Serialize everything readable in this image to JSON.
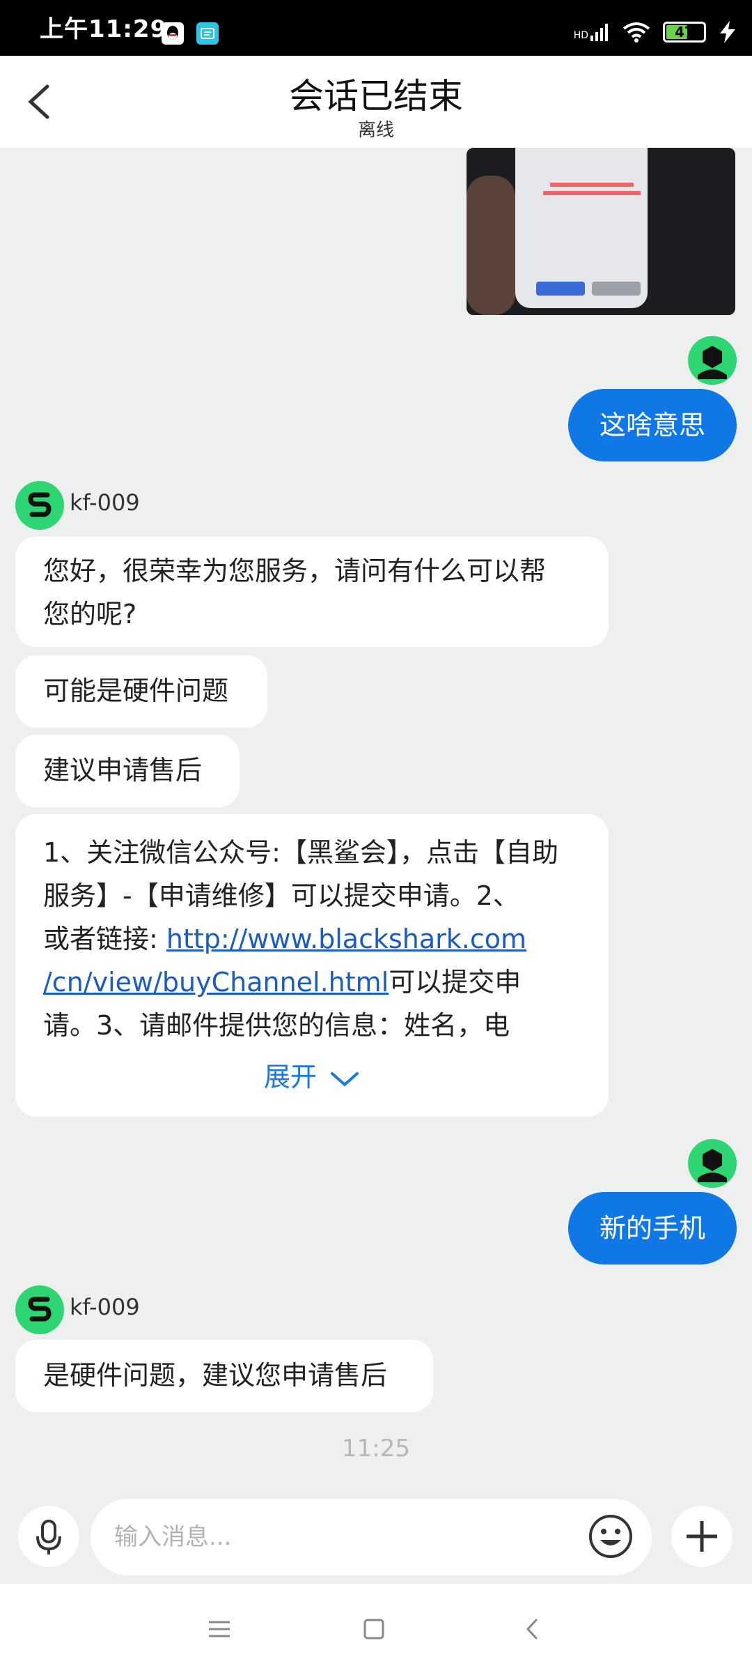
{
  "status_bar": {
    "time": "上午11:29",
    "network": "HD",
    "battery": "47"
  },
  "header": {
    "title": "会话已结束",
    "subtitle": "离线"
  },
  "messages": {
    "user1": "这啥意思",
    "bot_name1": "kf-009",
    "bot1_a": "您好，很荣幸为您服务，请问有什么可以帮",
    "bot1_b": "您的呢?",
    "bot2": "可能是硬件问题",
    "bot3": "建议申请售后",
    "bot4": {
      "line1": "1、关注微信公众号:【黑鲨会】，点击【自助",
      "line2": "服务】-【申请维修】可以提交申请。2、",
      "line3_pre": "或者链接: ",
      "line3_link": "http://www.blackshark.com",
      "line4_link": "/cn/view/buyChannel.html",
      "line4_post": "可以提交申",
      "line5": "请。3、请邮件提供您的信息：姓名，电",
      "expand_label": "展开"
    },
    "user2": "新的手机",
    "bot_name2": "kf-009",
    "bot5": "是硬件问题，建议您申请售后",
    "timestamp": "11:25"
  },
  "input": {
    "placeholder": "输入消息..."
  },
  "icons": {
    "back": "chevron-left-icon",
    "mic": "microphone-icon",
    "emoji": "smiley-icon",
    "add": "plus-icon"
  },
  "colors": {
    "accent": "#1077e6",
    "avatar": "#2ed573",
    "link": "#1a5cc4"
  }
}
